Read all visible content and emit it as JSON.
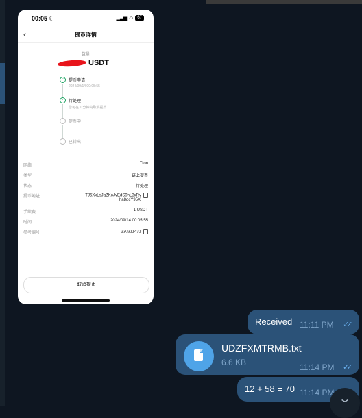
{
  "phone": {
    "status_time": "00:05",
    "status_moon": "☾",
    "status_signal": "▂▄▆",
    "status_wifi": "◠",
    "battery": "67",
    "nav_title": "提币详情",
    "amount_label": "数量",
    "amount_unit": "USDT",
    "steps": [
      {
        "title": "提币申请",
        "sub": "2024/09/14 00:05:55"
      },
      {
        "title": "待处理",
        "sub": "您可在 1 分钟内取消提币"
      },
      {
        "title": "提币中",
        "sub": ""
      },
      {
        "title": "已转出",
        "sub": ""
      }
    ],
    "details": {
      "network": {
        "label": "网络",
        "value": "Tron"
      },
      "type": {
        "label": "类型",
        "value": "链上提币"
      },
      "status": {
        "label": "状态",
        "value": "待处理"
      },
      "address": {
        "label": "提币地址",
        "value_line1": "TJ6XxLsJqZKoJvEdS9hL3xRv",
        "value_line2": "ha8dcY95X"
      },
      "fee": {
        "label": "手续费",
        "value": "1 USDT"
      },
      "time": {
        "label": "时间",
        "value": "2024/09/14 00:05:55"
      },
      "ref": {
        "label": "参考编号",
        "value": "230311431"
      }
    },
    "cancel_label": "取消提币"
  },
  "chat": {
    "messages": [
      {
        "text": "Received",
        "time": "11:11 PM",
        "check": "✓✓"
      },
      {
        "file_name": "UDZFXMTRMB.txt",
        "file_size": "6.6 KB",
        "time": "11:14 PM",
        "check": "✓✓"
      },
      {
        "text": "12 + 58 = 70",
        "time": "11:14 PM",
        "check": "✓✓"
      }
    ],
    "scroll_down_icon": "⌄"
  },
  "colors": {
    "background": "#0e1621",
    "bubble": "#2b5278",
    "timestamp": "#7ea4c8",
    "check": "#6cb2f0",
    "file_icon": "#4fa4e8",
    "redaction": "#e8141b",
    "step_done": "#1aa260"
  }
}
